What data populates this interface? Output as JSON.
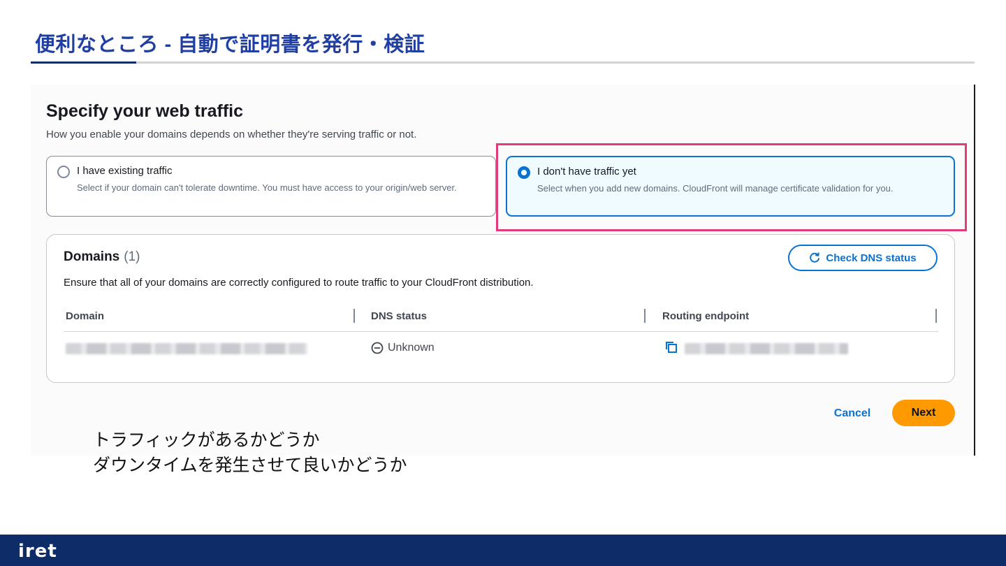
{
  "slide": {
    "title": "便利なところ - 自動で証明書を発行・検証",
    "notes": [
      "トラフィックがあるかどうか",
      "ダウンタイムを発生させて良いかどうか"
    ],
    "logo": "iret"
  },
  "page": {
    "title": "Specify your web traffic",
    "subtitle": "How you enable your domains depends on whether they're serving traffic or not."
  },
  "options": [
    {
      "label": "I have existing traffic",
      "description": "Select if your domain can't tolerate downtime. You must have access to your origin/web server.",
      "selected": false
    },
    {
      "label": "I don't have traffic yet",
      "description": "Select when you add new domains. CloudFront will manage certificate validation for you.",
      "selected": true
    }
  ],
  "domains": {
    "title": "Domains",
    "count": "(1)",
    "description": "Ensure that all of your domains are correctly configured to route traffic to your CloudFront distribution.",
    "check_button": "Check DNS status",
    "columns": [
      "Domain",
      "DNS status",
      "Routing endpoint"
    ],
    "rows": [
      {
        "dns_status": "Unknown"
      }
    ]
  },
  "actions": {
    "cancel": "Cancel",
    "next": "Next"
  },
  "colors": {
    "title_blue": "#1f3fa3",
    "brand_navy": "#0e2c68",
    "primary": "#0972d3",
    "highlight": "#e13b7c",
    "next_button": "#ff9900"
  },
  "icons": {
    "check_button": "refresh-icon",
    "dns_status": "unknown-status-icon",
    "routing_endpoint": "copy-icon"
  }
}
